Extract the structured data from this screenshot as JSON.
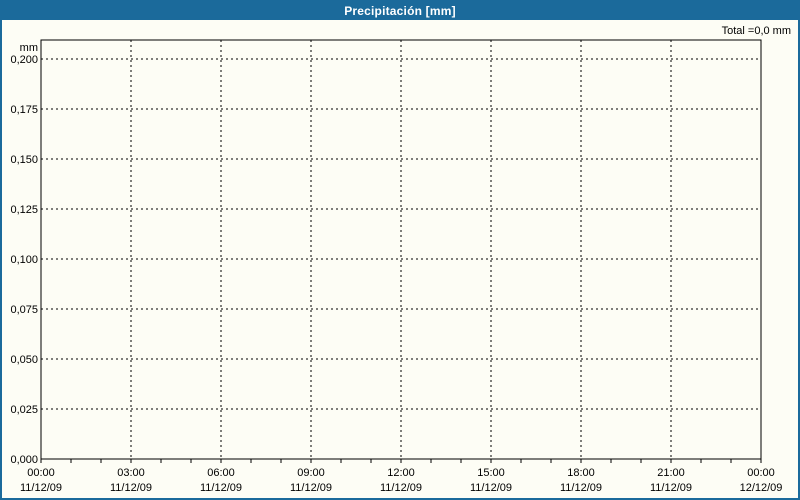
{
  "window": {
    "title": "Precipitación [mm]"
  },
  "colors": {
    "titlebar_bg": "#1B6A9B",
    "window_border": "#1B6A9B",
    "background": "#FDFDF5",
    "title_text": "#FFFFFF",
    "axis_line": "#000000",
    "grid_line": "#000000",
    "label_text": "#000000"
  },
  "chart_data": {
    "type": "line",
    "title": "Precipitación [mm]",
    "total_label": "Total =0,0 mm",
    "ylabel": "mm",
    "xlabel": "",
    "yticks": [
      "0,200",
      "0,175",
      "0,150",
      "0,125",
      "0,100",
      "0,075",
      "0,050",
      "0,025",
      "0,000"
    ],
    "ytick_step": 0.025,
    "ylim": [
      0,
      0.21
    ],
    "xticks": [
      {
        "time": "00:00",
        "date": "11/12/09"
      },
      {
        "time": "03:00",
        "date": "11/12/09"
      },
      {
        "time": "06:00",
        "date": "11/12/09"
      },
      {
        "time": "09:00",
        "date": "11/12/09"
      },
      {
        "time": "12:00",
        "date": "11/12/09"
      },
      {
        "time": "15:00",
        "date": "11/12/09"
      },
      {
        "time": "18:00",
        "date": "11/12/09"
      },
      {
        "time": "21:00",
        "date": "11/12/09"
      },
      {
        "time": "00:00",
        "date": "12/12/09"
      }
    ],
    "minor_xtick_hours": 1,
    "major_xtick_hours": 3,
    "grid": true,
    "legend": "none",
    "series": [],
    "note": "No precipitation data plotted; chart area is empty and total equals 0,0 mm"
  }
}
